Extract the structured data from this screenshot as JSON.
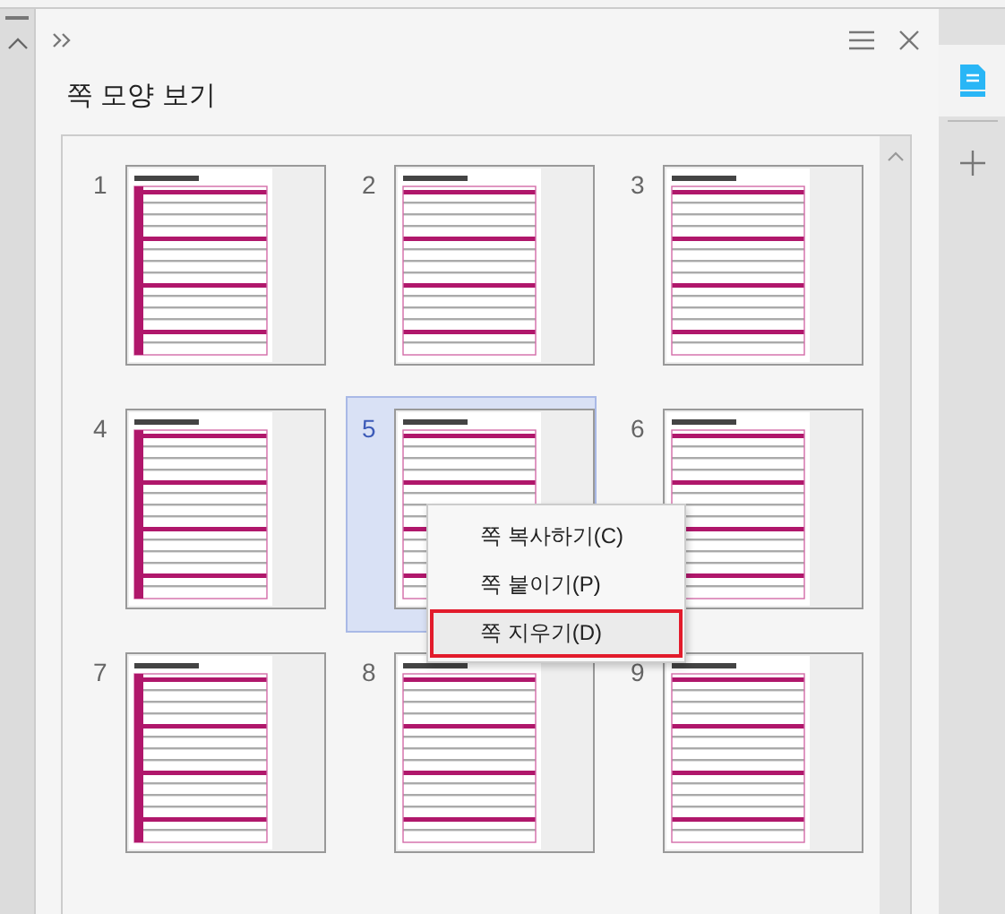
{
  "panel": {
    "title": "쪽 모양 보기"
  },
  "pages": [
    {
      "number": "1",
      "selected": false
    },
    {
      "number": "2",
      "selected": false
    },
    {
      "number": "3",
      "selected": false
    },
    {
      "number": "4",
      "selected": false
    },
    {
      "number": "5",
      "selected": true
    },
    {
      "number": "6",
      "selected": false
    },
    {
      "number": "7",
      "selected": false
    },
    {
      "number": "8",
      "selected": false
    },
    {
      "number": "9",
      "selected": false
    }
  ],
  "context_menu": [
    {
      "label": "쪽 복사하기(C)",
      "highlighted": false
    },
    {
      "label": "쪽 붙이기(P)",
      "highlighted": false
    },
    {
      "label": "쪽 지우기(D)",
      "highlighted": true
    }
  ]
}
